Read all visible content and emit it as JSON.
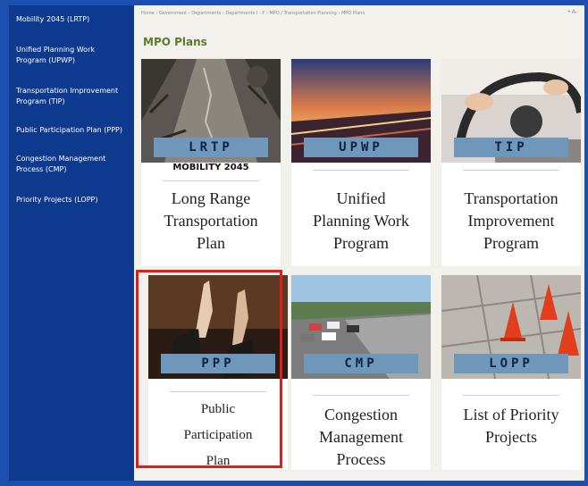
{
  "sidebar": {
    "items": [
      {
        "label": "Mobility 2045 (LRTP)"
      },
      {
        "label": "Unified Planning Work Program (UPWP)"
      },
      {
        "label": "Transportation Improvement Program (TIP)"
      },
      {
        "label": "Public Participation Plan (PPP)"
      },
      {
        "label": "Congestion Management Process (CMP)"
      },
      {
        "label": "Priority Projects (LOPP)"
      }
    ]
  },
  "header": {
    "breadcrumb": "Home › Government › Departments › Departments I - P › MPO / Transportation Planning › MPO Plans",
    "tools": "+ A-"
  },
  "page": {
    "title": "MPO Plans"
  },
  "cards": [
    {
      "banner": "LRTP",
      "subbrand": "MOBILITY 2045",
      "title_lines": [
        "Long Range",
        "Transportation",
        "Plan"
      ]
    },
    {
      "banner": "UPWP",
      "title_lines": [
        "Unified",
        "Planning Work",
        "Program"
      ]
    },
    {
      "banner": "TIP",
      "title_lines": [
        "Transportation",
        "Improvement",
        "Program"
      ]
    },
    {
      "banner": "PPP",
      "title_lines": [
        "Public",
        "Participation",
        "Plan"
      ]
    },
    {
      "banner": "CMP",
      "title_lines": [
        "Congestion",
        "Management",
        "Process"
      ]
    },
    {
      "banner": "LOPP",
      "title_lines": [
        "List of Priority",
        "Projects"
      ]
    }
  ],
  "colors": {
    "sidebar": "#0d3a8e",
    "border": "#1d4fb0",
    "title_green": "#5b7a2f",
    "banner": "#6f97bb",
    "highlight": "#e31b1b"
  }
}
